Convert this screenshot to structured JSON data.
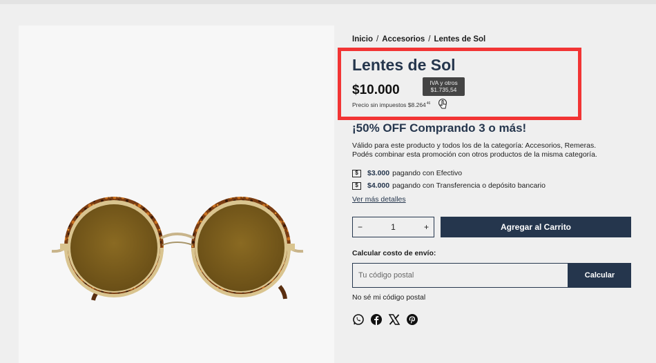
{
  "breadcrumb": [
    "Inicio",
    "Accesorios",
    "Lentes de Sol"
  ],
  "breadcrumb_separator": "/",
  "product": {
    "title": "Lentes de Sol",
    "price": "$10.000",
    "tax_tooltip": [
      "IVA y otros",
      "$1.735,54"
    ],
    "pretax_label": "Precio sin impuestos $8.264",
    "pretax_cents": "46"
  },
  "promo": {
    "title": "¡50% OFF Comprando 3 o más!",
    "line1": "Válido para este producto y todos los de la categoría: Accesorios, Remeras.",
    "line2": "Podés combinar esta promoción con otros productos de la misma categoría."
  },
  "payments": [
    {
      "icon": "$",
      "amount": "$3.000",
      "method": "pagando con Efectivo"
    },
    {
      "icon": "$",
      "amount": "$4.000",
      "method": "pagando con Transferencia o depósito bancario"
    }
  ],
  "details_link": "Ver más detalles",
  "quantity": {
    "minus": "−",
    "value": "1",
    "plus": "+"
  },
  "add_to_cart": "Agregar al Carrito",
  "shipping": {
    "label": "Calcular costo de envío:",
    "placeholder": "Tu código postal",
    "button": "Calcular",
    "unknown_link": "No sé mi código postal"
  },
  "share_icons": [
    "whatsapp-icon",
    "facebook-icon",
    "x-icon",
    "pinterest-icon"
  ],
  "colors": {
    "accent": "#25364d",
    "highlight": "#f23434",
    "tooltip": "#444444"
  }
}
